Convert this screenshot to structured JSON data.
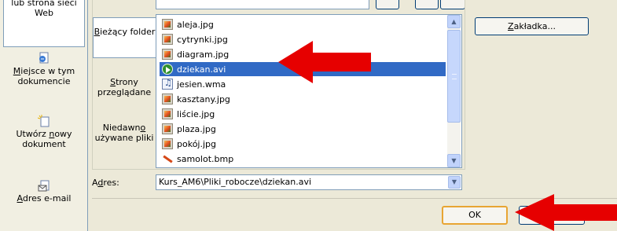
{
  "window": {
    "title": ""
  },
  "link_bar": {
    "items": [
      {
        "label_pre": "",
        "label_u": "",
        "label_post": "lub strona sieci Web",
        "icon": "globe-page-icon"
      },
      {
        "label_pre": "",
        "label_u": "M",
        "label_post": "iejsce w tym dokumencie",
        "icon": "document-place-icon"
      },
      {
        "label_pre": "Utwórz ",
        "label_u": "n",
        "label_post": "owy dokument",
        "icon": "new-document-icon"
      },
      {
        "label_pre": "",
        "label_u": "A",
        "label_post": "dres e-mail",
        "icon": "email-icon"
      }
    ]
  },
  "look_in": {
    "tabs": [
      {
        "label_pre": "",
        "label_u": "B",
        "label_post": "ieżący folder"
      },
      {
        "label_pre": "",
        "label_u": "S",
        "label_post": "trony przeglądane"
      },
      {
        "label_pre": "Niedawn",
        "label_u": "o",
        "label_post": " używane pliki"
      }
    ]
  },
  "files": [
    {
      "name": "aleja.jpg",
      "type": "img"
    },
    {
      "name": "cytrynki.jpg",
      "type": "img"
    },
    {
      "name": "diagram.jpg",
      "type": "img"
    },
    {
      "name": "dziekan.avi",
      "type": "avi",
      "selected": true
    },
    {
      "name": "jesien.wma",
      "type": "wma"
    },
    {
      "name": "kasztany.jpg",
      "type": "img"
    },
    {
      "name": "liście.jpg",
      "type": "img"
    },
    {
      "name": "plaza.jpg",
      "type": "img"
    },
    {
      "name": "pokój.jpg",
      "type": "img"
    },
    {
      "name": "samolot.bmp",
      "type": "bmp"
    }
  ],
  "bookmark_button": {
    "label_pre": "",
    "label_u": "Z",
    "label_post": "akładka..."
  },
  "address": {
    "label_pre": "A",
    "label_u": "d",
    "label_post": "res:",
    "value": "Kurs_AM6\\Pliki_robocze\\dziekan.avi"
  },
  "buttons": {
    "ok": "OK",
    "cancel": ""
  },
  "colors": {
    "selection": "#316ac5",
    "arrow": "#e60000",
    "dialog_bg": "#ece9d8"
  }
}
